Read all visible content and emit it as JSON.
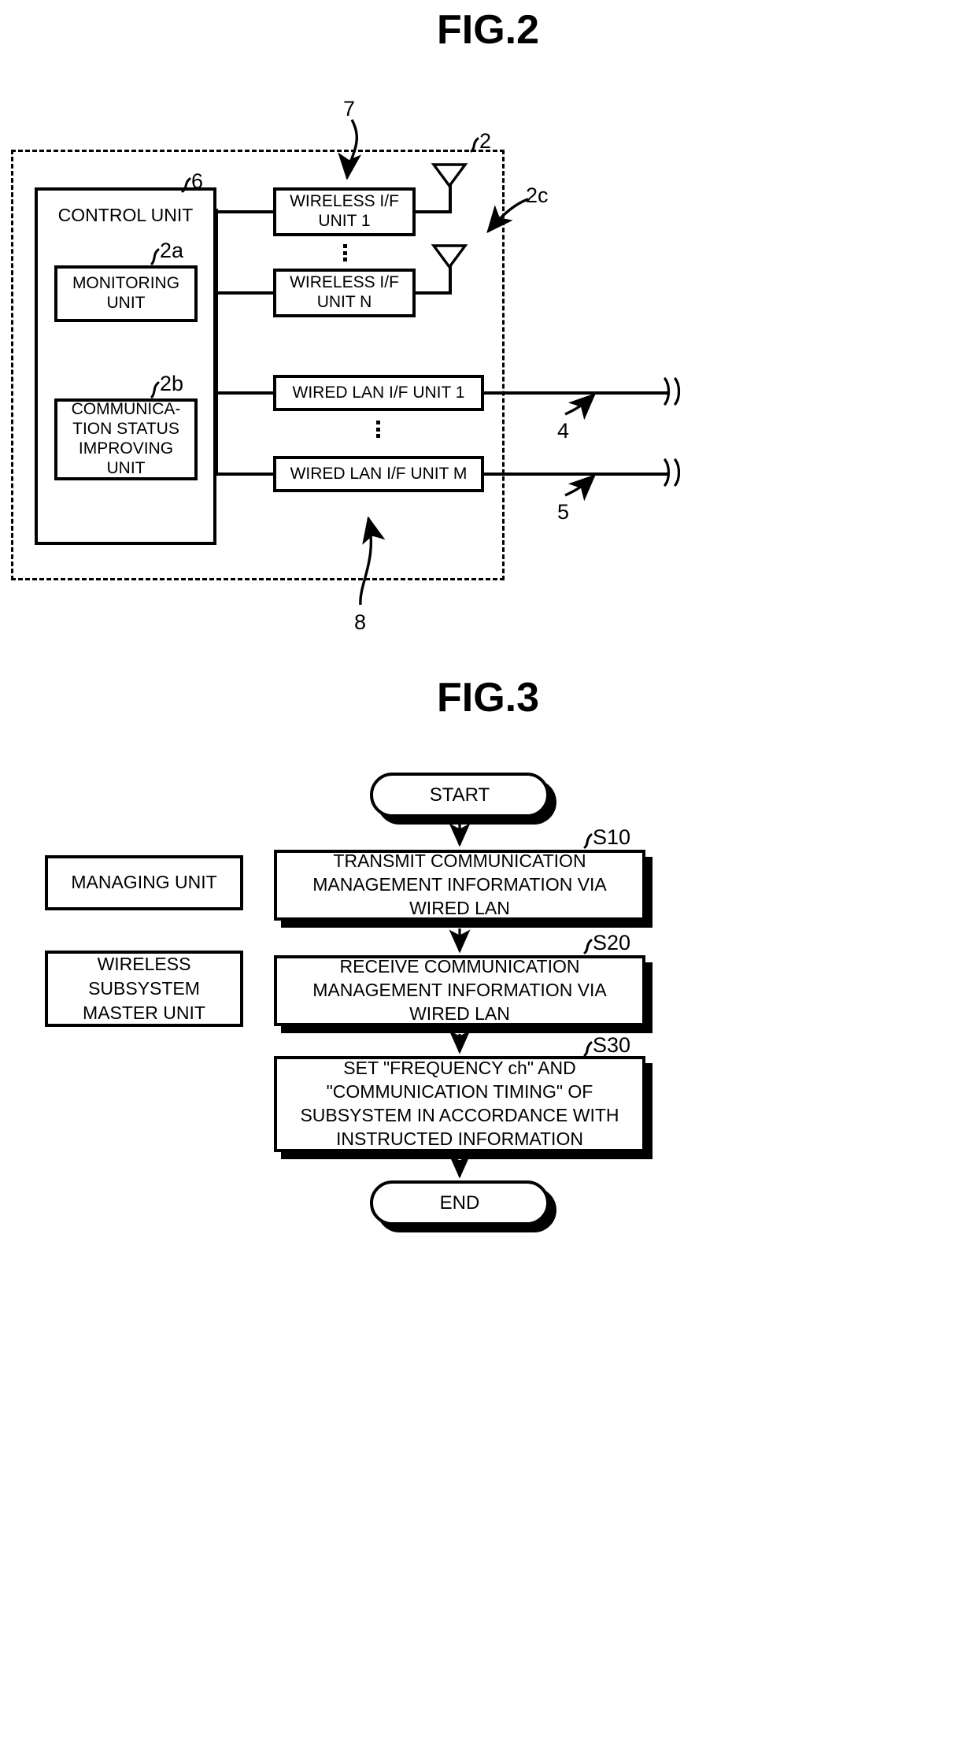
{
  "figures": {
    "fig2": {
      "title": "FIG.2",
      "enclosure_ref": "2",
      "control_unit": {
        "label": "CONTROL UNIT",
        "ref": "6"
      },
      "monitoring_unit": {
        "label": "MONITORING UNIT",
        "line1": "MONITORING",
        "line2": "UNIT",
        "ref": "2a"
      },
      "comm_status_unit": {
        "label": "COMMUNICATION STATUS IMPROVING UNIT",
        "line1": "COMMUNICA-",
        "line2": "TION STATUS",
        "line3": "IMPROVING",
        "line4": "UNIT",
        "ref": "2b"
      },
      "wireless_if_1": {
        "line1": "WIRELESS I/F",
        "line2": "UNIT 1",
        "ref": "7"
      },
      "wireless_if_n": {
        "line1": "WIRELESS I/F",
        "line2": "UNIT N"
      },
      "antenna_ref": "2c",
      "wired_lan_1": {
        "label": "WIRED LAN I/F UNIT 1",
        "ref": "4"
      },
      "wired_lan_m": {
        "label": "WIRED LAN I/F UNIT M",
        "ref": "5"
      },
      "wired_bus_ref": "8"
    },
    "fig3": {
      "title": "FIG.3",
      "start_label": "START",
      "end_label": "END",
      "actors": [
        {
          "label": "MANAGING UNIT",
          "lines": [
            "MANAGING UNIT"
          ]
        },
        {
          "label": "WIRELESS SUBSYSTEM MASTER UNIT",
          "lines": [
            "WIRELESS",
            "SUBSYSTEM",
            "MASTER UNIT"
          ]
        }
      ],
      "steps": [
        {
          "ref": "S10",
          "lines": [
            "TRANSMIT COMMUNICATION",
            "MANAGEMENT INFORMATION VIA",
            "WIRED LAN"
          ]
        },
        {
          "ref": "S20",
          "lines": [
            "RECEIVE COMMUNICATION",
            "MANAGEMENT INFORMATION VIA",
            "WIRED LAN"
          ]
        },
        {
          "ref": "S30",
          "lines": [
            "SET \"FREQUENCY ch\" AND",
            "\"COMMUNICATION TIMING\" OF",
            "SUBSYSTEM IN ACCORDANCE WITH",
            "INSTRUCTED INFORMATION"
          ]
        }
      ]
    }
  },
  "colors": {
    "ink": "#000000",
    "paper": "#ffffff"
  }
}
